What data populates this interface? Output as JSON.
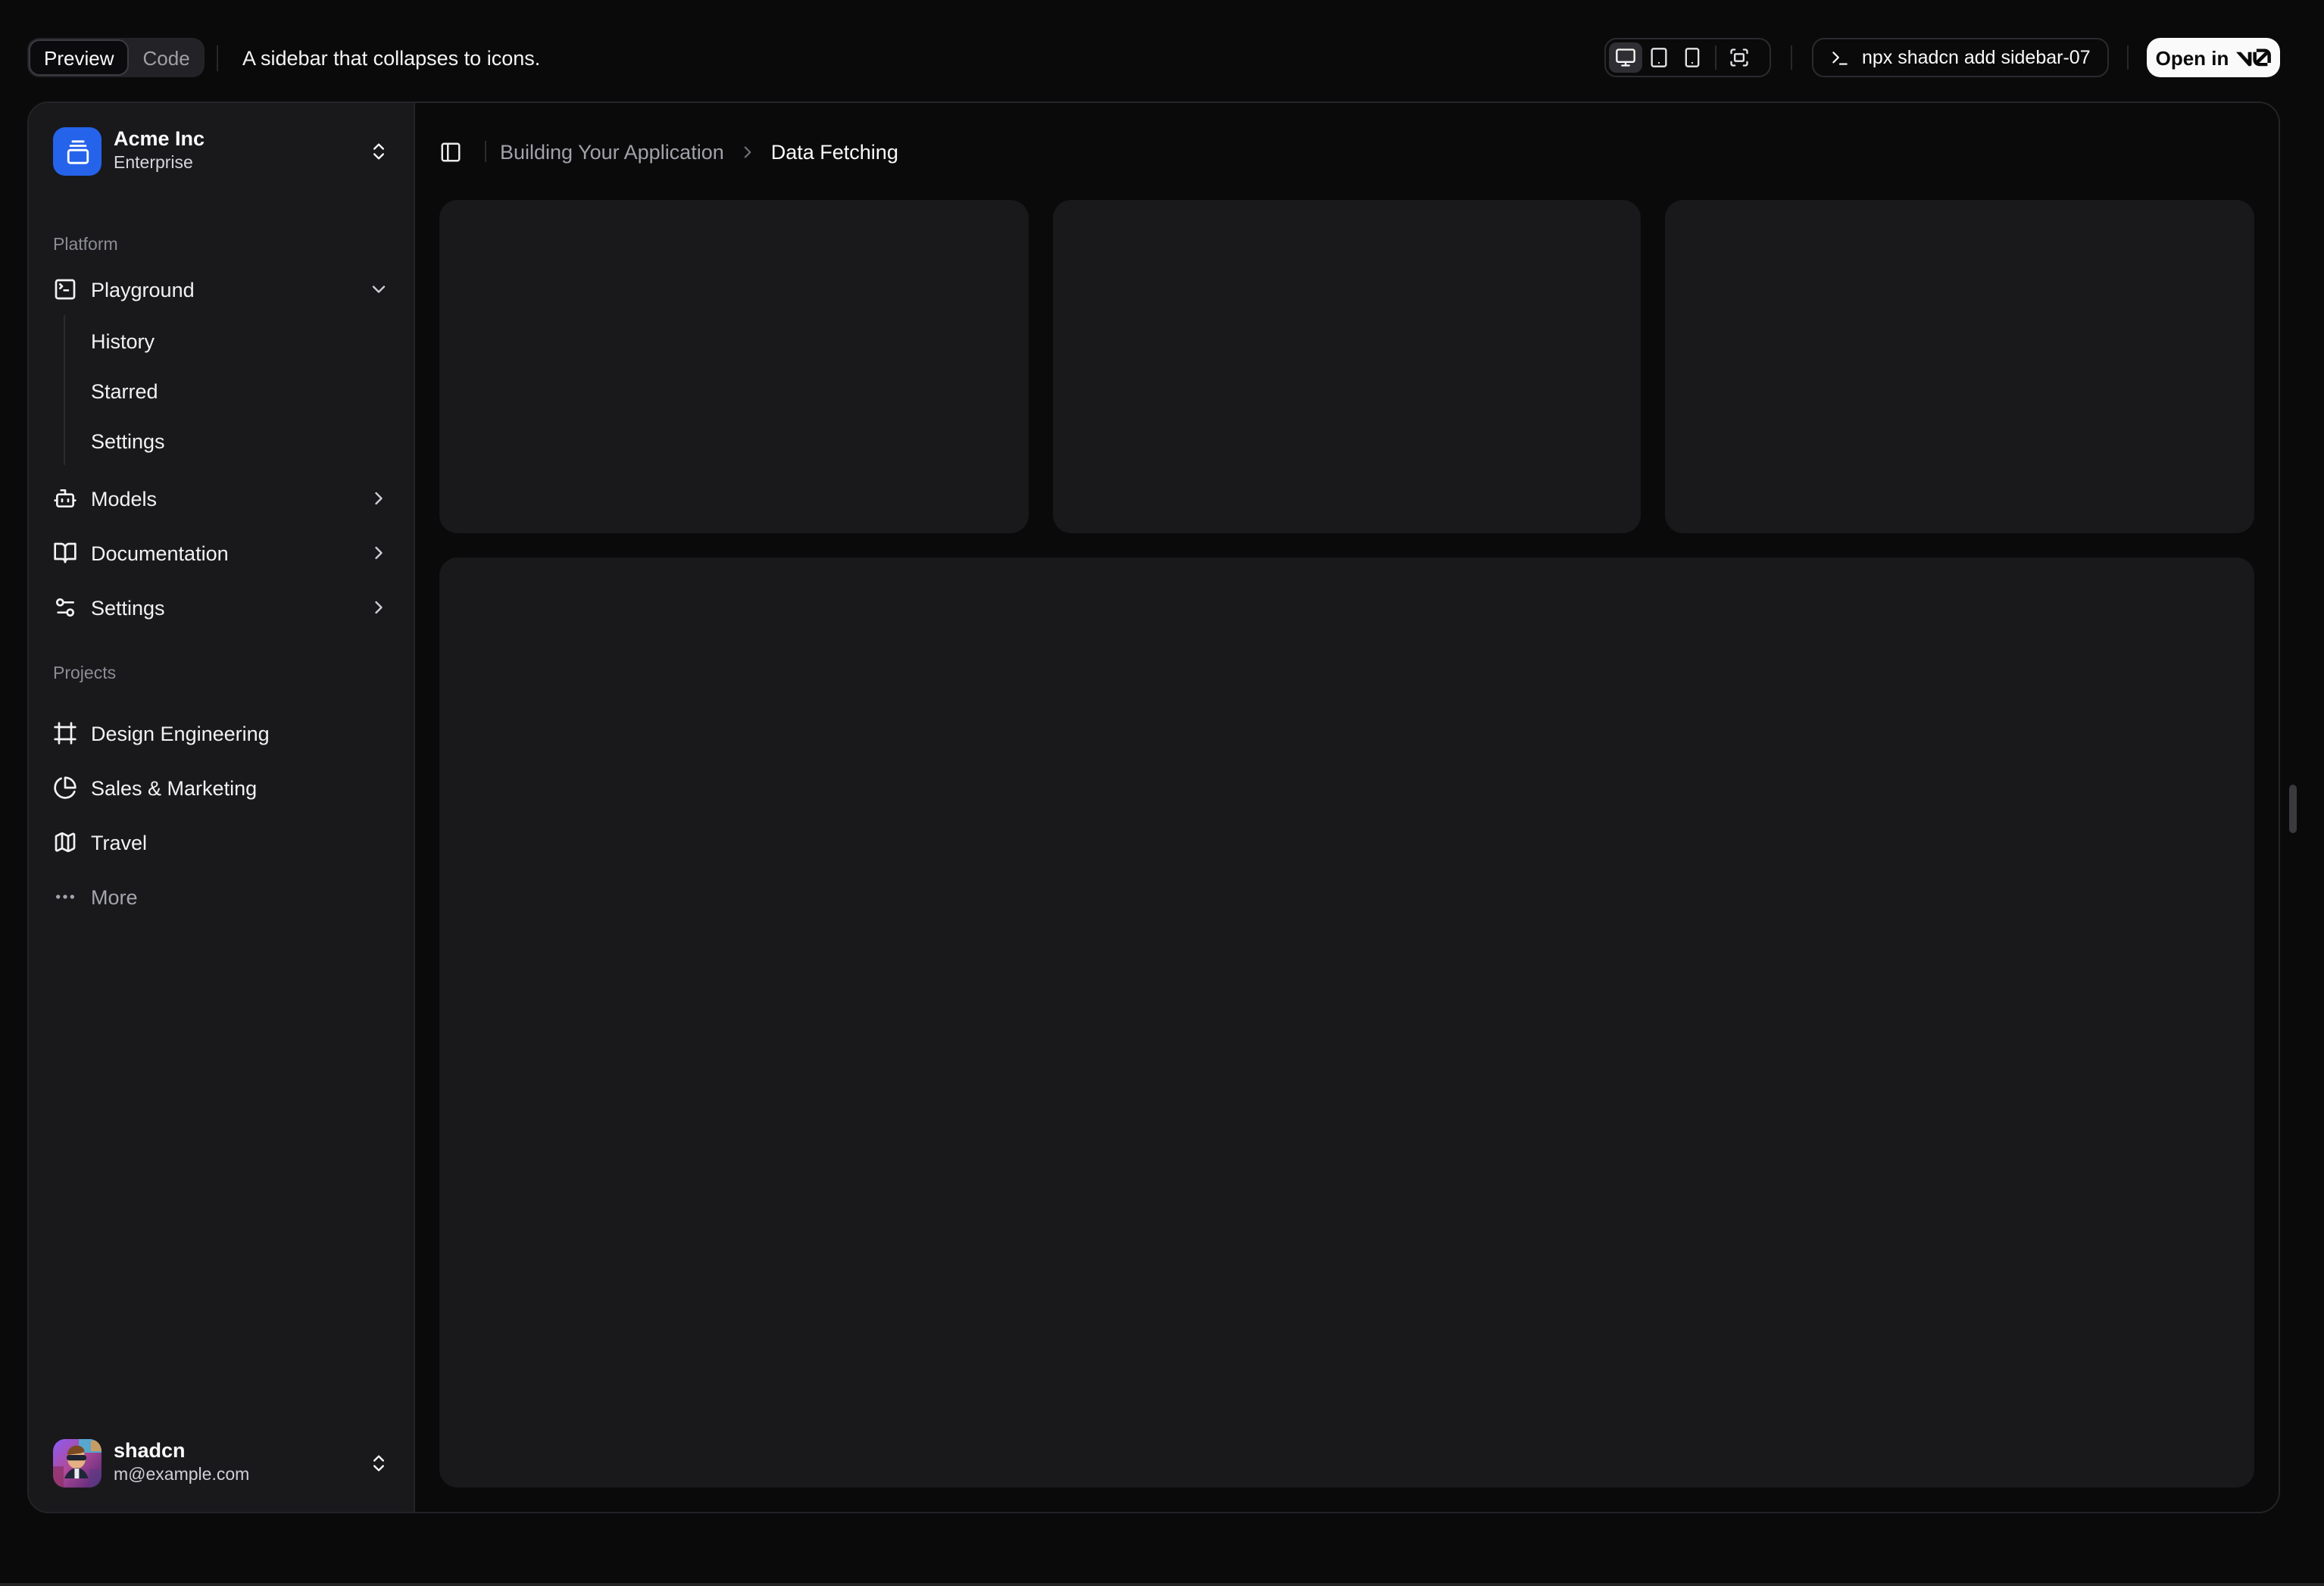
{
  "toolbar": {
    "tabs": {
      "preview": "Preview",
      "code": "Code"
    },
    "description": "A sidebar that collapses to icons.",
    "command": "npx shadcn add sidebar-07",
    "open_in": "Open in",
    "open_in_logo": "v0"
  },
  "sidebar": {
    "org": {
      "name": "Acme Inc",
      "plan": "Enterprise"
    },
    "platform": {
      "label": "Platform",
      "playground": "Playground",
      "playground_sub": [
        "History",
        "Starred",
        "Settings"
      ],
      "models": "Models",
      "documentation": "Documentation",
      "settings": "Settings"
    },
    "projects": {
      "label": "Projects",
      "items": [
        "Design Engineering",
        "Sales & Marketing",
        "Travel"
      ],
      "more": "More"
    },
    "user": {
      "name": "shadcn",
      "email": "m@example.com"
    }
  },
  "breadcrumb": {
    "section": "Building Your Application",
    "page": "Data Fetching"
  },
  "colors": {
    "accent_blue": "#2563eb",
    "open_in_button_bg": "#fafafa",
    "sidebar_bg": "#19191c",
    "card_bg": "#19191c",
    "page_bg": "#0a0a0b"
  }
}
